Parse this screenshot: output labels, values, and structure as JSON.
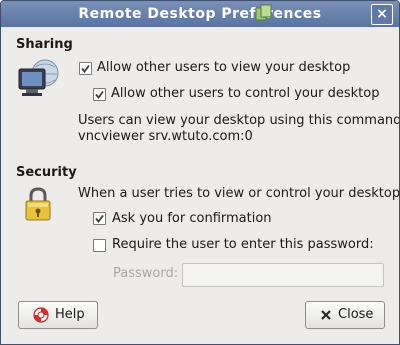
{
  "window": {
    "title": "Remote Desktop Preferences",
    "close_glyph": "×"
  },
  "sharing": {
    "heading": "Sharing",
    "allow_view_label": "Allow other users to view your desktop",
    "allow_view_checked": true,
    "allow_control_label": "Allow other users to control your desktop",
    "allow_control_checked": true,
    "command_hint": "Users can view your desktop using this command:",
    "command": "vncviewer srv.wtuto.com:0"
  },
  "security": {
    "heading": "Security",
    "prompt": "When a user tries to view or control your desktop:",
    "ask_confirmation_label": "Ask you for confirmation",
    "ask_confirmation_checked": true,
    "require_password_label": "Require the user to enter this password:",
    "require_password_checked": false,
    "password_label": "Password:",
    "password_value": ""
  },
  "buttons": {
    "help_label": "Help",
    "close_label": "Close"
  },
  "icons": {
    "sharing": "remote-desktop-icon",
    "security": "padlock-icon",
    "help": "lifebuoy-icon",
    "close": "close-icon"
  },
  "colors": {
    "titlebar": "#5a73a0",
    "window_bg": "#edeceb",
    "check": "#3d3d3d"
  }
}
